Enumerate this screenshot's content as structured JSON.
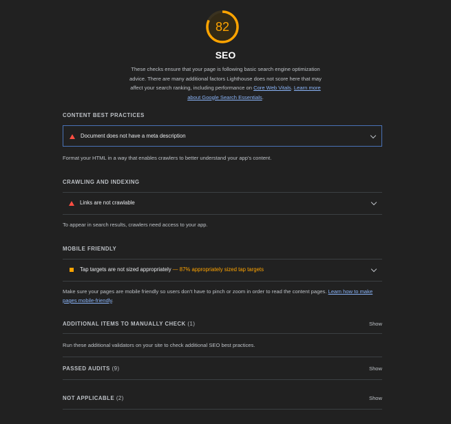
{
  "category": {
    "score": "82",
    "score_fraction": 0.82,
    "title": "SEO",
    "description": "These checks ensure that your page is following basic search engine optimization advice. There are many additional factors Lighthouse does not score here that may affect your search ranking, including performance on",
    "link_core_web_vitals": "Core Web Vitals",
    "link_sep": ". ",
    "link_learn_more": "Learn more about Google Search Essentials",
    "desc_end": ".",
    "colors": {
      "score": "#ffa400",
      "fail": "#ff4e42",
      "link": "#8ab4f8"
    }
  },
  "groups": {
    "content": {
      "title": "CONTENT BEST PRACTICES",
      "audit_title": "Document does not have a meta description",
      "audit_icon": "fail-triangle-icon",
      "description": "Format your HTML in a way that enables crawlers to better understand your app's content."
    },
    "crawling": {
      "title": "CRAWLING AND INDEXING",
      "audit_title": "Links are not crawlable",
      "audit_icon": "fail-triangle-icon",
      "description": "To appear in search results, crawlers need access to your app."
    },
    "mobile": {
      "title": "MOBILE FRIENDLY",
      "audit_title": "Tap targets are not sized appropriately",
      "audit_display": " — 87% appropriately sized tap targets",
      "audit_icon": "average-square-icon",
      "description": "Make sure your pages are mobile friendly so users don't have to pinch or zoom in order to read the content pages.",
      "link": "Learn how to make pages mobile-friendly",
      "desc_end": "."
    },
    "manual": {
      "title": "ADDITIONAL ITEMS TO MANUALLY CHECK",
      "count": "(1)",
      "show": "Show",
      "description": "Run these additional validators on your site to check additional SEO best practices."
    },
    "passed": {
      "title": "PASSED AUDITS",
      "count": "(9)",
      "show": "Show"
    },
    "notapplicable": {
      "title": "NOT APPLICABLE",
      "count": "(2)",
      "show": "Show"
    }
  }
}
